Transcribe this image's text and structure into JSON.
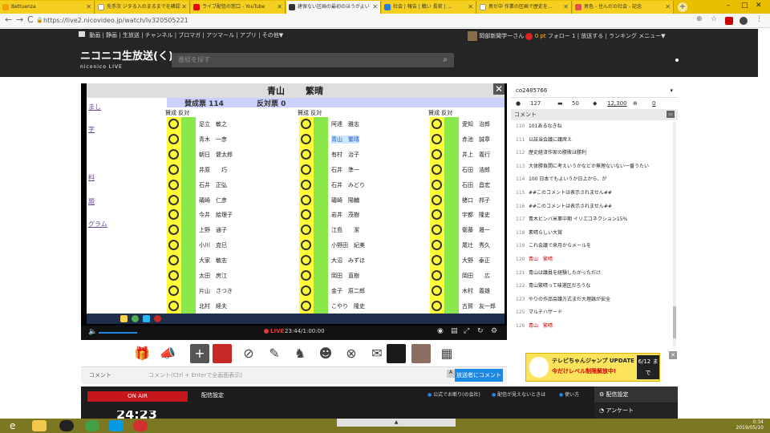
{
  "browser": {
    "tabs": [
      {
        "label": "Bettuenza",
        "active": false
      },
      {
        "label": "先手次 ジタる入のまるまでを確認",
        "active": false
      },
      {
        "label": "ライブ配信の窓口 - YouTube",
        "active": false
      },
      {
        "label": "建保ない区画の最初のほうがよい",
        "active": true
      },
      {
        "label": "社会 | 報告 | 戦い 長官 | ...",
        "active": false
      },
      {
        "label": "男だ中 作業の区画で歴史を...",
        "active": false
      },
      {
        "label": "男色 - 住んだの社会 - 記念",
        "active": false
      }
    ],
    "new_tab_label": "+",
    "url": "https://live2.nicovideo.jp/watch/lv320505221",
    "nav": {
      "back": "←",
      "forward": "→",
      "reload": "C"
    }
  },
  "nico_header": {
    "nav_items": [
      "動画",
      "静画",
      "生放送",
      "チャンネル",
      "ブロマガ",
      "アツマール",
      "アプリ",
      "その他▼"
    ],
    "user_name": "岡部新聞学一さん",
    "points": "0 pt",
    "follow": "フォロー 1",
    "broadcast": "放送する",
    "ranking": "ランキング",
    "menu": "メニュー▼",
    "logo_main": "ニコニコ生放送(く)",
    "logo_sub": "niconico LIVE",
    "search_placeholder": "番組を探す"
  },
  "video": {
    "title_left": "青山",
    "title_right": "繁晴",
    "tally_yes": "賛成票 114",
    "tally_no": "反対票 0",
    "header_label": "賛成 反対",
    "left_links": [
      "まし",
      "字",
      "料",
      "題",
      "グラム"
    ],
    "col1_names": [
      "足立　敏之",
      "青木　一彦",
      "朝日　健太郎",
      "井原　　巧",
      "石井　正弘",
      "礒崎　仁彦",
      "今井　絵理子",
      "上野　通子",
      "小川　克巳",
      "大家　敏志",
      "太田　房江",
      "片山　さつき",
      "北村　経夫",
      "上月　良祐"
    ],
    "col2_names": [
      "阿達　雅志",
      "青山　繁晴",
      "有村　治子",
      "石井　準一",
      "石井　みどり",
      "礒崎　陽輔",
      "岩井　茂樹",
      "江島　　潔",
      "小野田　紀美",
      "大沼　みずほ",
      "岡田　直樹",
      "金子　原二郎",
      "こやり　隆史",
      "佐藤　　啓"
    ],
    "col3_names": [
      "愛知　治郎",
      "赤池　誠章",
      "井上　義行",
      "石田　浩郎",
      "石田　昌宏",
      "猪口　邦子",
      "宇都　隆史",
      "衛藤　晟一",
      "尾辻　秀久",
      "大野　泰正",
      "岡田　　広",
      "木村　義雄",
      "古賀　友一郎",
      "佐藤　信秋"
    ]
  },
  "player": {
    "live_label": "LIVE",
    "time": "23:44/1:00:00"
  },
  "comment_input": {
    "label": "コメント",
    "placeholder": "コメント(Ctrl + Enterで全画面表示)",
    "submit": "放送者にコメント"
  },
  "bottom": {
    "onair": "ON AIR",
    "settings_title": "配信設定",
    "links": [
      "公式でお断り(の会社)",
      "配信が見えないときは",
      "使い方"
    ],
    "setting_btn": "配信設定",
    "questionnaire": "アンケート",
    "big_number": "24:23"
  },
  "panel": {
    "community": "co2485766",
    "stats": {
      "viewers": "127",
      "comments": "50",
      "ads": "12,300",
      "gifts": "0"
    },
    "comment_header": "コメント",
    "comments": [
      {
        "no": "110",
        "text": "101あるなきね",
        "highlight": false
      },
      {
        "no": "111",
        "text": "以該当会議に議席え",
        "highlight": false
      },
      {
        "no": "112",
        "text": "歴史経済作家の勝敗は勝利",
        "highlight": false
      },
      {
        "no": "113",
        "text": "大体勝負間に考えいうかなどか無理ないない一番うたい",
        "highlight": false
      },
      {
        "no": "114",
        "text": "100 日本でもよいうか日上から、が",
        "highlight": false
      },
      {
        "no": "115",
        "text": "##このコメントは表示されません##",
        "highlight": false
      },
      {
        "no": "116",
        "text": "##このコメントは表示されません##",
        "highlight": false
      },
      {
        "no": "117",
        "text": "青木ビンバ米軍中期 イリエコネクション15%",
        "highlight": false
      },
      {
        "no": "118",
        "text": "素晴らしい大賞",
        "highlight": false
      },
      {
        "no": "119",
        "text": "これ会議で来月からメールを",
        "highlight": false
      },
      {
        "no": "120",
        "text": "青山　繁晴",
        "highlight": true
      },
      {
        "no": "121",
        "text": "青山は議員を経験したかっただけ",
        "highlight": false
      },
      {
        "no": "122",
        "text": "青山繁晴って味選区だろうな",
        "highlight": false
      },
      {
        "no": "123",
        "text": "やりの作品会議方式まだ大理論が安全",
        "highlight": false
      },
      {
        "no": "125",
        "text": "マルチハザード",
        "highlight": false
      },
      {
        "no": "126",
        "text": "青山　繁晴",
        "highlight": true
      }
    ],
    "ad_title": "テレビちゃんジャンプ UPDATE",
    "ad_sub": "今だけレベル制限解放中!",
    "ad_date": "6/12 まで"
  },
  "taskbar": {
    "clock_time": "0:34",
    "clock_date": "2019/05/10"
  }
}
